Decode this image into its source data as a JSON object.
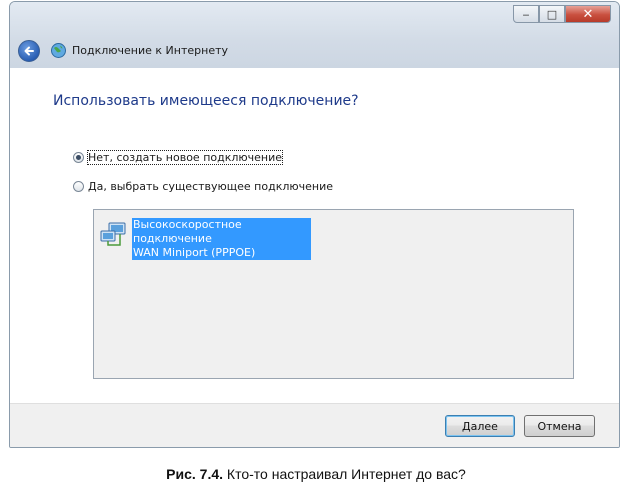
{
  "window": {
    "title": "Подключение к Интернету",
    "controls": {
      "minimize": "‒",
      "maximize": "□",
      "close": "✕"
    }
  },
  "main": {
    "heading": "Использовать имеющееся подключение?",
    "options": [
      {
        "label": "Нет, создать новое подключение",
        "checked": true
      },
      {
        "label": "Да, выбрать существующее подключение",
        "checked": false
      }
    ],
    "connections": [
      {
        "name": "Высокоскоростное подключение",
        "device": "WAN Miniport (PPPOE)",
        "selected": true
      }
    ]
  },
  "footer": {
    "next_label": "Далее",
    "cancel_label": "Отмена"
  },
  "caption": {
    "prefix": "Рис. 7.4.",
    "text": " Кто-то настраивал Интернет до вас?"
  },
  "colors": {
    "heading": "#1e3a8a",
    "selection": "#3399ff",
    "close_button": "#c9503f"
  }
}
